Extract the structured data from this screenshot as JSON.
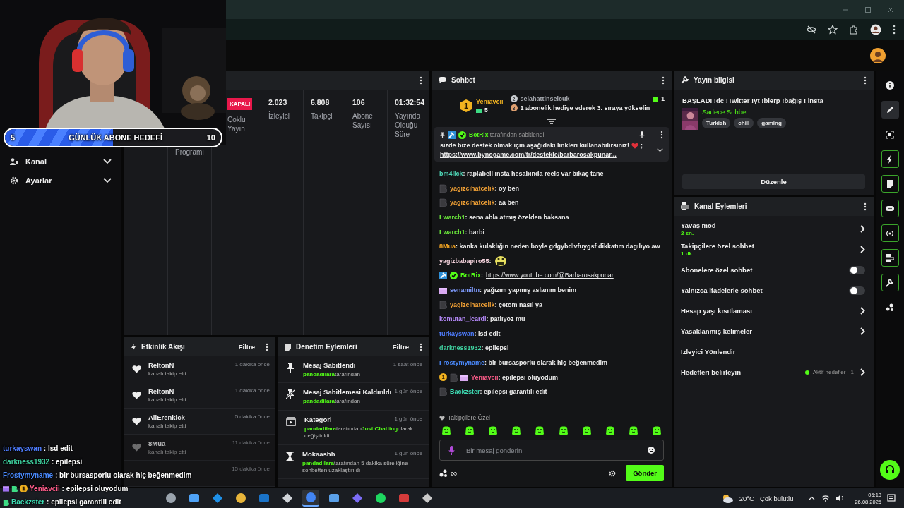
{
  "stats": {
    "cells": [
      {
        "label": "Programı"
      },
      {
        "badge": "KAPALI",
        "label": "Çoklu Yayın"
      },
      {
        "value": "2.023",
        "label": "İzleyici"
      },
      {
        "value": "6.808",
        "label": "Takipçi"
      },
      {
        "value": "106",
        "label": "Abone Sayısı"
      },
      {
        "value": "01:32:54",
        "label": "Yayında Olduğu Süre"
      }
    ]
  },
  "goal": {
    "current": "5",
    "title": "GÜNLÜK ABONE HEDEFİ",
    "target": "10",
    "level": 0.5
  },
  "sidebar": {
    "items": [
      {
        "label": "Kanal",
        "expanded": false
      },
      {
        "label": "Ayarlar",
        "expanded": false
      }
    ]
  },
  "events": {
    "title": "Etkinlik Akışı",
    "filter": "Filtre",
    "items": [
      {
        "user": "ReltonN",
        "action": "kanalı takip etti",
        "time": "1 dakika önce",
        "faded": false
      },
      {
        "user": "ReltonN",
        "action": "kanalı takip etti",
        "time": "1 dakika önce",
        "faded": false
      },
      {
        "user": "AliErenkick",
        "action": "kanalı takip etti",
        "time": "5 dakika önce",
        "faded": false
      },
      {
        "user": "8Mua",
        "action": "kanalı takip etti",
        "time": "11 dakika önce",
        "faded": true
      },
      {
        "time": "15 dakika önce",
        "faded": true
      }
    ]
  },
  "mod_actions": {
    "title": "Denetim Eylemleri",
    "filter": "Filtre",
    "items": [
      {
        "kind": "pin",
        "title": "Mesaj Sabitlendi",
        "time": "1 saat önce",
        "parts": [
          {
            "text": "pandadilara",
            "highlight": true
          },
          {
            "text": "tarafından",
            "highlight": false
          }
        ]
      },
      {
        "kind": "unpin",
        "title": "Mesaj Sabitlemesi Kaldırıldı",
        "time": "1 gün önce",
        "parts": [
          {
            "text": "pandadilara",
            "highlight": true
          },
          {
            "text": "tarafından",
            "highlight": false
          }
        ]
      },
      {
        "kind": "category",
        "title": "Kategori",
        "time": "1 gün önce",
        "parts": [
          {
            "text": "pandadilara",
            "highlight": true
          },
          {
            "text": "tarafından",
            "highlight": false
          },
          {
            "text": "Just Chatting",
            "highlight": true
          },
          {
            "text": "olarak değiştirildi",
            "highlight": false
          }
        ]
      },
      {
        "kind": "timeout",
        "title": "Mokaashh",
        "time": "1 gün önce",
        "parts": [
          {
            "text": "pandadilara",
            "highlight": true
          },
          {
            "text": "tarafından 5 dakika süreliğine sohbetten uzaklaştırıldı",
            "highlight": false
          }
        ]
      }
    ]
  },
  "chat": {
    "title": "Sohbet",
    "leaders": [
      {
        "rank": "1",
        "user": "Yeniavcii",
        "count": "5"
      },
      {
        "rank": "2",
        "user": "selahattinselcuk",
        "count": "1"
      }
    ],
    "leader_hint": {
      "rank": "3",
      "text": "1 abonelik hediye ederek 3. sıraya yükselin"
    },
    "pinned": {
      "by": "BotRix",
      "by_suffix": "tarafından sabitlendi",
      "text": "sizde bize destek olmak için aşağıdaki linkleri kullanabilirsiniz!",
      "text_end": ";",
      "link": "https://www.bynogame.com/tr/destekle/barbarosakpunar..."
    },
    "messages": [
      {
        "user": "bm4llck",
        "color": "#4fd8b8",
        "text": ": raplabell insta hesabında reels var bikaç tane"
      },
      {
        "user": "yagizcihatcelik",
        "color": "#f0a035",
        "badges": [
          {
            "kind": "sub"
          }
        ],
        "text": ": oy ben"
      },
      {
        "user": "yagizcihatcelik",
        "color": "#f0a035",
        "badges": [
          {
            "kind": "sub"
          }
        ],
        "text": ": aa ben"
      },
      {
        "user": "Lwarch1",
        "color": "#6ef03c",
        "text": ": sena abla atmış özelden baksana"
      },
      {
        "user": "Lwarch1",
        "color": "#6ef03c",
        "text": ": barbi"
      },
      {
        "user": "8Mua",
        "color": "#f5a623",
        "text": ": kanka kulaklığın neden boyle gdgybdlvfuygsf dikkatım dagılıyo aw"
      },
      {
        "user": "yagizbabapiro55",
        "color": "#f4d2dc",
        "text": ":",
        "emote": true
      },
      {
        "user": "BotRix",
        "color": "#53fc18",
        "badges": [
          {
            "kind": "mod"
          },
          {
            "kind": "verified"
          }
        ],
        "text": ":",
        "link": "https://www.youtube.com/@Barbarosakpunar"
      },
      {
        "user": "senamiltn",
        "color": "#7f9cff",
        "badges": [
          {
            "kind": "gift"
          }
        ],
        "text": ": yağızım yapmış aslanım benim"
      },
      {
        "user": "yagizcihatcelik",
        "color": "#f0a035",
        "badges": [
          {
            "kind": "sub"
          }
        ],
        "text": ": çetom nasıl ya"
      },
      {
        "user": "komutan_icardi",
        "color": "#b98cff",
        "text": ": patlıyoz mu"
      },
      {
        "user": "turkayswan",
        "color": "#4f7dff",
        "text": ": lsd edit"
      },
      {
        "user": "darkness1932",
        "color": "#3fd2a0",
        "text": ": epilepsi"
      },
      {
        "user": "Frostymyname",
        "color": "#4b8bff",
        "text": ": bir bursasporlu olarak hiç beğenmedim"
      },
      {
        "user": "Yeniavcii",
        "color": "#ff5c8a",
        "badges": [
          {
            "kind": "leader",
            "text": "1"
          },
          {
            "kind": "sub"
          },
          {
            "kind": "gift"
          }
        ],
        "text": ": epilepsi oluyodum"
      },
      {
        "user": "Backzster",
        "color": "#3ddbb3",
        "badges": [
          {
            "kind": "sub"
          }
        ],
        "text": ": epilepsi garantili edit"
      }
    ],
    "emote_label": "Takipçilere Özel",
    "placeholder": "Bir mesaj gönderin",
    "infinity": "∞",
    "send": "Gönder"
  },
  "stream_info": {
    "title": "Yayın bilgisi",
    "stream_title": "BAŞLADI !dc !Twitter !yt !blerp !bağış ! insta",
    "category": "Sadece Sohbet",
    "tags": [
      "Turkish",
      "chill",
      "gaming"
    ],
    "edit": "Düzenle"
  },
  "channel_actions": {
    "title": "Kanal Eylemleri",
    "items": [
      {
        "kind": "link",
        "label": "Yavaş mod",
        "value": "2 sn."
      },
      {
        "kind": "link",
        "label": "Takipçilere özel sohbet",
        "value": "1 dk."
      },
      {
        "kind": "toggle",
        "label": "Abonelere özel sohbet",
        "on": false
      },
      {
        "kind": "toggle",
        "label": "Yalnızca ifadelerle sohbet",
        "on": false
      },
      {
        "kind": "link",
        "label": "Hesap yaşı kısıtlaması"
      },
      {
        "kind": "link",
        "label": "Yasaklanmış kelimeler"
      },
      {
        "kind": "plain",
        "label": "İzleyici Yönlendir"
      },
      {
        "kind": "status",
        "label": "Hedefleri belirleyin",
        "value": "Aktif hedefler - 1"
      }
    ]
  },
  "rail": [
    {
      "selected": false,
      "pinned": false
    },
    {
      "selected": true,
      "pinned": false
    },
    {
      "selected": false,
      "pinned": false
    },
    {
      "selected": false,
      "pinned": true
    },
    {
      "selected": false,
      "pinned": true
    },
    {
      "selected": false,
      "pinned": true
    },
    {
      "selected": false,
      "pinned": true
    },
    {
      "selected": false,
      "pinned": true
    },
    {
      "selected": false,
      "pinned": true
    },
    {
      "selected": false,
      "pinned": false
    }
  ],
  "overlay_chat": [
    {
      "user": "turkayswan",
      "color": "#4f7dff",
      "text": ": lsd edit"
    },
    {
      "user": "darkness1932",
      "color": "#3fd2a0",
      "text": ": epilepsi"
    },
    {
      "user": "Frostymyname",
      "color": "#4b8bff",
      "text": ": bir bursasporlu olarak hiç beğenmedim"
    },
    {
      "user": "Yeniavcii",
      "color": "#ff5c8a",
      "badges": [
        {
          "kind": "gift"
        },
        {
          "kind": "sub"
        },
        {
          "kind": "leader",
          "text": "1"
        }
      ],
      "text": ": epilepsi oluyodum"
    },
    {
      "user": "Backzster",
      "color": "#3ddbb3",
      "badges": [
        {
          "kind": "sub"
        }
      ],
      "text": ": epilepsi garantili edit"
    }
  ],
  "taskbar": {
    "apps": [
      {
        "selected": false
      },
      {
        "selected": false
      },
      {
        "selected": false
      },
      {
        "selected": false
      },
      {
        "selected": false
      },
      {
        "selected": false
      },
      {
        "selected": true
      },
      {
        "selected": false
      },
      {
        "selected": false
      },
      {
        "selected": false
      },
      {
        "selected": false
      },
      {
        "selected": false
      }
    ],
    "weather": {
      "temp": "20°C",
      "desc": "Çok bulutlu"
    },
    "time": "05:13",
    "date": "26.08.2025"
  }
}
